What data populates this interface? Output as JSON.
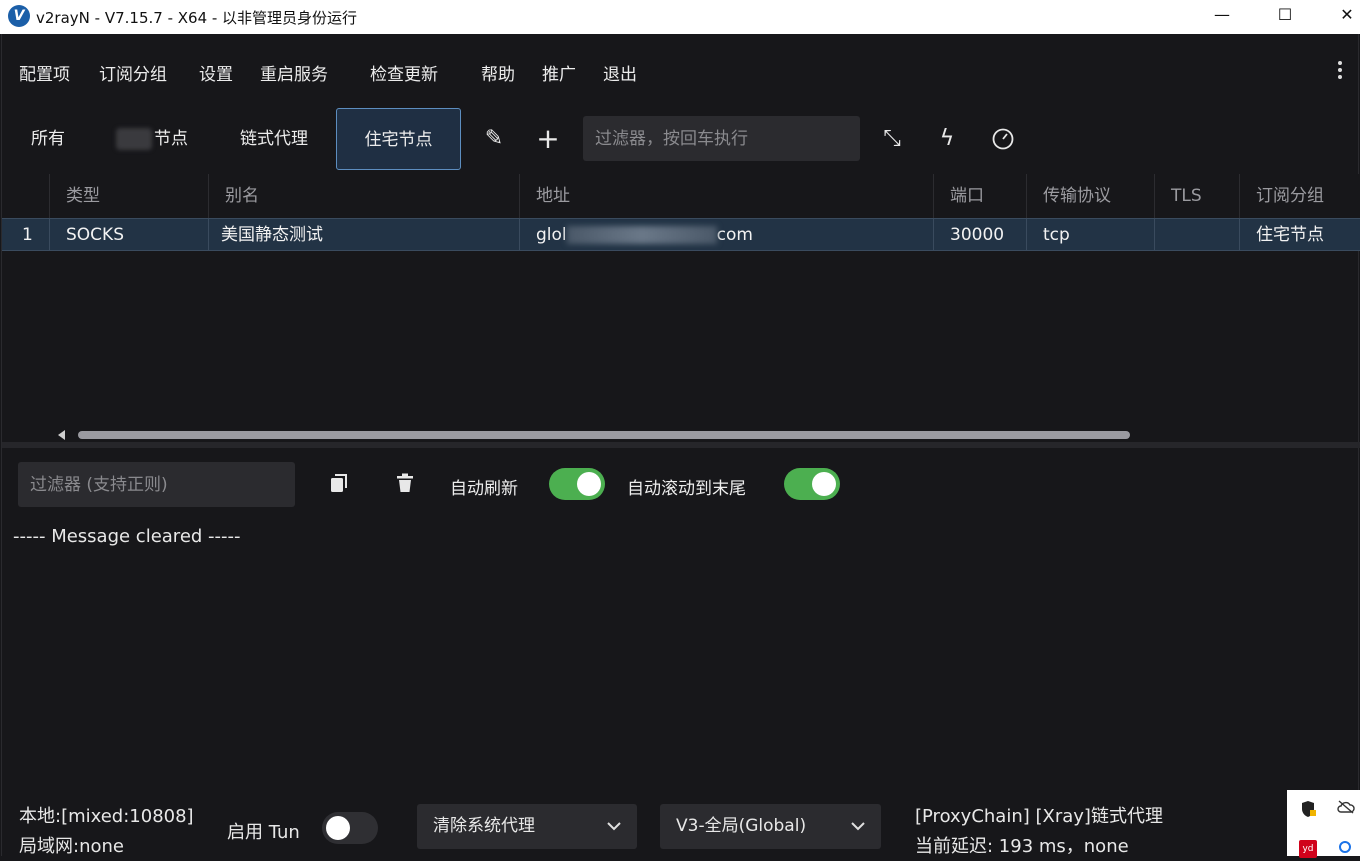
{
  "window": {
    "title": "v2rayN - V7.15.7 - X64 - 以非管理员身份运行",
    "logo_letter": "V",
    "minimize": "—",
    "maximize": "☐",
    "close": "✕"
  },
  "menu": {
    "items": [
      "配置项",
      "订阅分组",
      "设置",
      "重启服务",
      "检查更新",
      "帮助",
      "推广",
      "退出"
    ]
  },
  "tabs": {
    "items": [
      {
        "label": "所有"
      },
      {
        "label": "节点"
      },
      {
        "label": "链式代理"
      },
      {
        "label": "住宅节点",
        "active": true
      }
    ],
    "icons": [
      "pencil-icon",
      "plus-icon",
      "expand-icon",
      "lightning-icon",
      "speedometer-icon"
    ],
    "filter_placeholder": "过滤器，按回车执行"
  },
  "grid": {
    "columns": [
      "类型",
      "别名",
      "地址",
      "端口",
      "传输协议",
      "TLS",
      "订阅分组"
    ],
    "rows": [
      {
        "index": "1",
        "type": "SOCKS",
        "alias": "美国静态测试",
        "addr_prefix": "glol",
        "addr_suffix": "com",
        "port": "30000",
        "transport": "tcp",
        "tls": "",
        "group": "住宅节点"
      }
    ]
  },
  "log": {
    "filter_placeholder": "过滤器 (支持正则)",
    "auto_refresh_label": "自动刷新",
    "auto_refresh": true,
    "auto_scroll_label": "自动滚动到末尾",
    "auto_scroll": true,
    "message": "----- Message cleared -----"
  },
  "status": {
    "local": "本地:[mixed:10808]",
    "lan": "局域网:none",
    "tun_label": "启用 Tun",
    "tun_enabled": false,
    "system_proxy": "清除系统代理",
    "routing": "V3-全局(Global)",
    "chain_info": "[ProxyChain] [Xray]链式代理",
    "latency": "当前延迟: 193 ms，none"
  },
  "colors": {
    "background": "#17171a",
    "selected_row": "#223345",
    "toggle_on": "#4caf50",
    "active_tab_border": "#5d8ec0"
  }
}
